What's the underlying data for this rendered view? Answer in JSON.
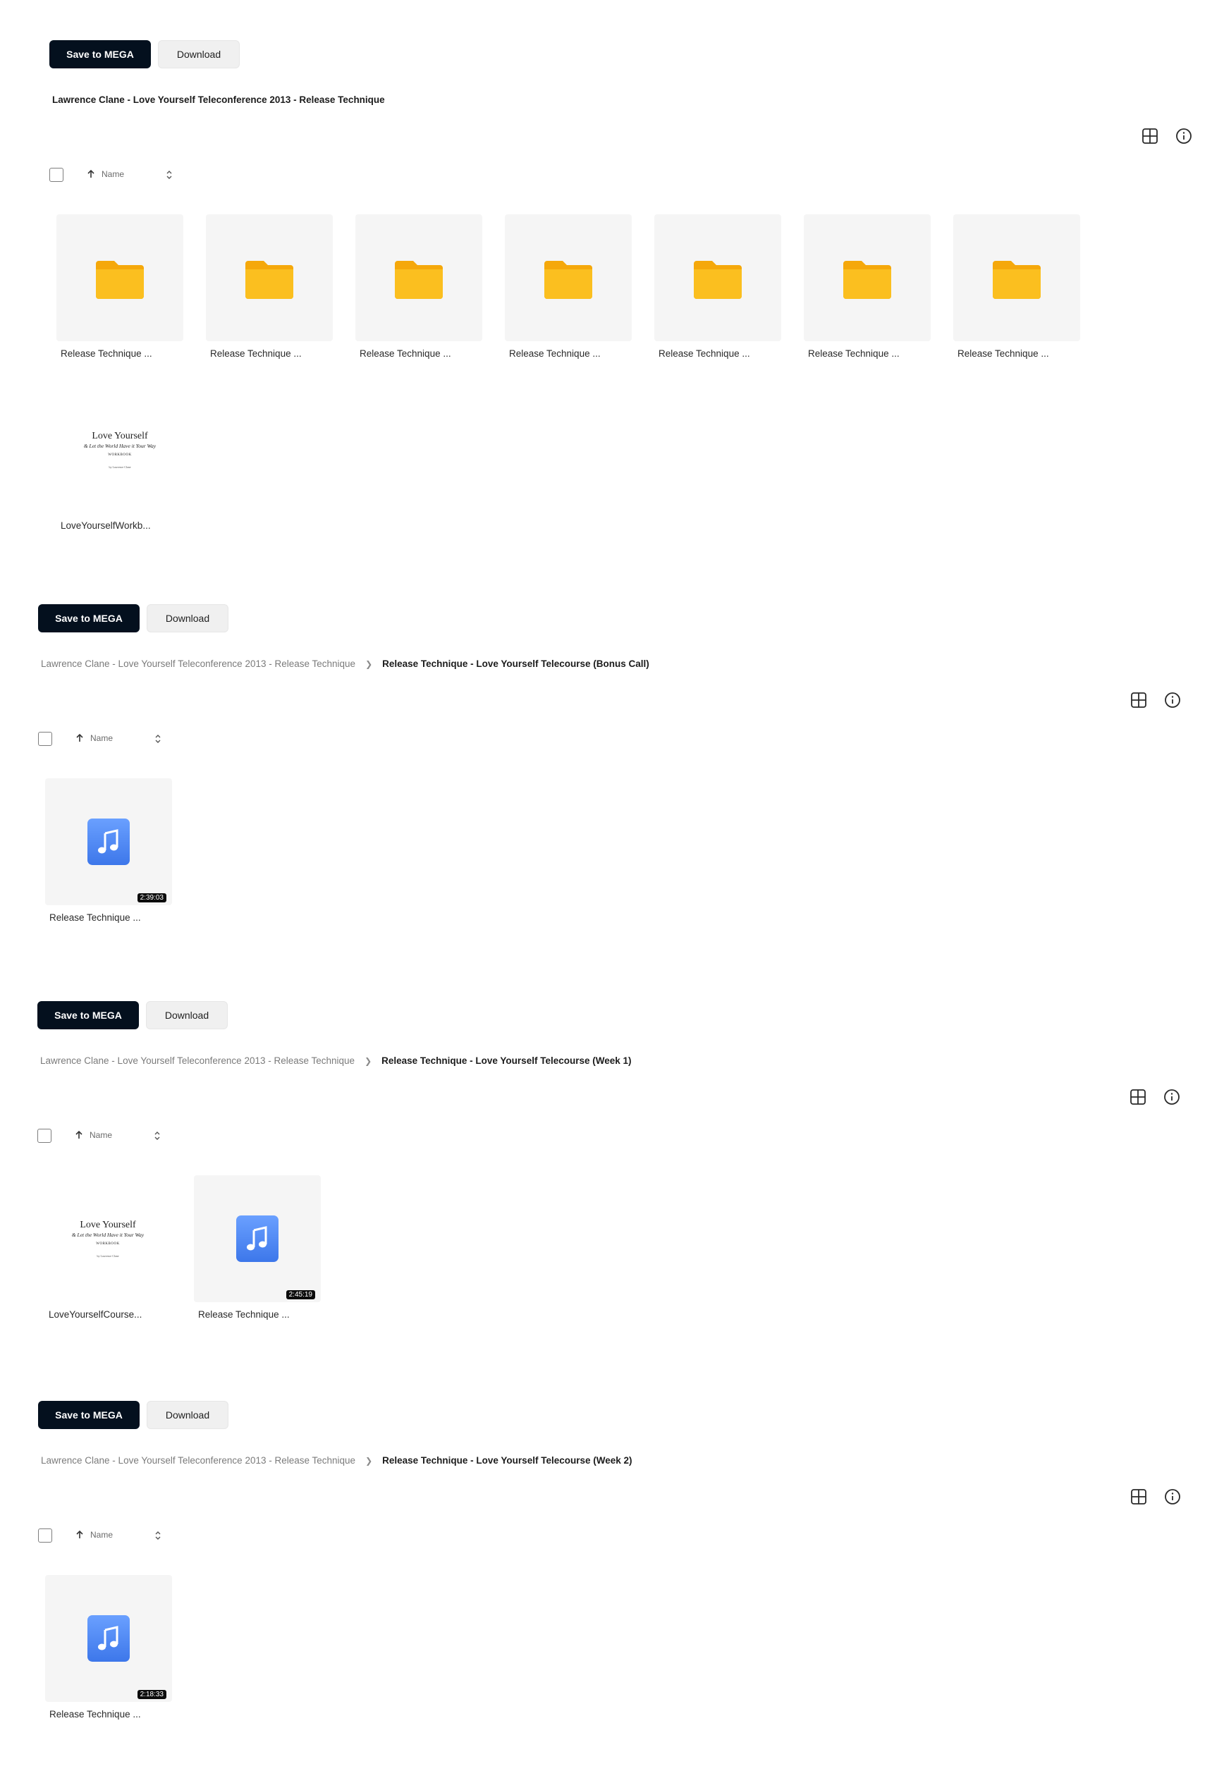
{
  "actions": {
    "save_label": "Save to MEGA",
    "download_label": "Download"
  },
  "sort": {
    "label": "Name"
  },
  "sections": [
    {
      "crumb_root": "Lawrence Clane - Love Yourself Teleconference 2013 - Release Technique",
      "crumb_leaf": "",
      "items": [
        {
          "type": "folder",
          "name": "Release Technique ..."
        },
        {
          "type": "folder",
          "name": "Release Technique ..."
        },
        {
          "type": "folder",
          "name": "Release Technique ..."
        },
        {
          "type": "folder",
          "name": "Release Technique ..."
        },
        {
          "type": "folder",
          "name": "Release Technique ..."
        },
        {
          "type": "folder",
          "name": "Release Technique ..."
        },
        {
          "type": "folder",
          "name": "Release Technique ..."
        },
        {
          "type": "document",
          "name": "LoveYourselfWorkb...",
          "preview_title": "Love Yourself",
          "preview_subtitle": "& Let the World Have it Your Way",
          "preview_label": "WORKBOOK",
          "preview_author": "by Lawrence Clane"
        }
      ]
    },
    {
      "crumb_root": "Lawrence Clane - Love Yourself Teleconference 2013 - Release Technique",
      "crumb_leaf": "Release Technique - Love Yourself Telecourse (Bonus Call)",
      "items": [
        {
          "type": "audio",
          "name": "Release Technique ...",
          "duration": "2:39:03"
        }
      ]
    },
    {
      "crumb_root": "Lawrence Clane - Love Yourself Teleconference 2013 - Release Technique",
      "crumb_leaf": "Release Technique - Love Yourself Telecourse (Week 1)",
      "items": [
        {
          "type": "document",
          "name": "LoveYourselfCourse...",
          "preview_title": "Love Yourself",
          "preview_subtitle": "& Let the World Have it Your Way",
          "preview_label": "WORKBOOK",
          "preview_author": "by Lawrence Clane"
        },
        {
          "type": "audio",
          "name": "Release Technique ...",
          "duration": "2:45:19"
        }
      ]
    },
    {
      "crumb_root": "Lawrence Clane - Love Yourself Teleconference 2013 - Release Technique",
      "crumb_leaf": "Release Technique - Love Yourself Telecourse (Week 2)",
      "items": [
        {
          "type": "audio",
          "name": "Release Technique ...",
          "duration": "2:18:33"
        }
      ]
    }
  ],
  "icons": {
    "view": "grid-view-icon",
    "info": "info-icon",
    "sort_arrow": "arrow-up-icon",
    "sort_toggle": "chevron-up-down-icon",
    "folder": "folder-icon",
    "audio": "music-note-icon"
  },
  "colors": {
    "primary_button": "#04101e",
    "folder": "#f7a80e",
    "audio": "#4d86f3"
  }
}
